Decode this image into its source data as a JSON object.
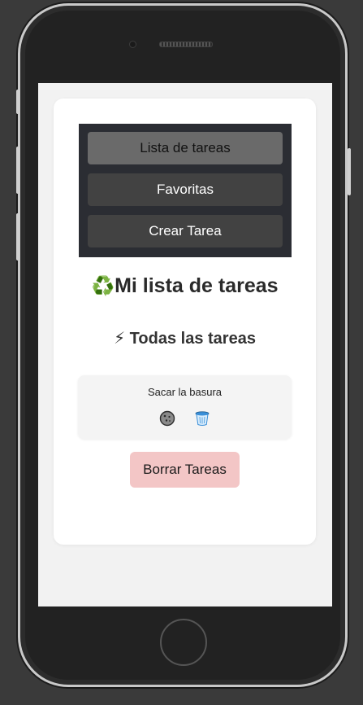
{
  "nav": {
    "items": [
      {
        "label": "Lista de tareas",
        "active": true
      },
      {
        "label": "Favoritas",
        "active": false
      },
      {
        "label": "Crear Tarea",
        "active": false
      }
    ]
  },
  "header": {
    "title_emoji": "♻️",
    "title": "Mi lista de tareas",
    "subtitle_emoji": "⚡",
    "subtitle": "Todas las tareas"
  },
  "tasks": [
    {
      "text": "Sacar la basura",
      "icons": [
        "cookie-icon",
        "trash-can-icon"
      ]
    }
  ],
  "actions": {
    "delete_all_label": "Borrar Tareas"
  },
  "colors": {
    "nav_background": "#2b2d33",
    "nav_item": "#424242",
    "nav_item_active": "#6a6a6a",
    "delete_button": "#f3c6c6"
  }
}
